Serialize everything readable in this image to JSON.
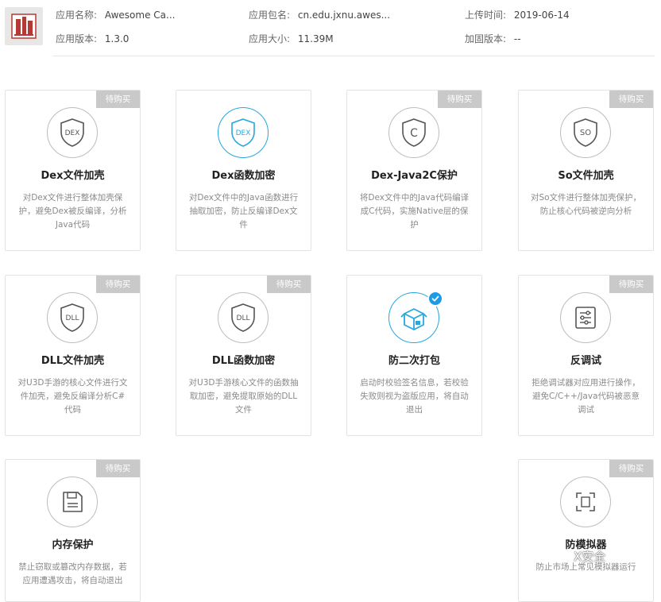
{
  "app": {
    "name_label": "应用名称:",
    "name_value": "Awesome Ca...",
    "package_label": "应用包名:",
    "package_value": "cn.edu.jxnu.awes...",
    "upload_label": "上传时间:",
    "upload_value": "2019-06-14",
    "version_label": "应用版本:",
    "version_value": "1.3.0",
    "size_label": "应用大小:",
    "size_value": "11.39M",
    "harden_label": "加固版本:",
    "harden_value": "--"
  },
  "ribbon_text": "待购买",
  "cards": [
    {
      "title": "Dex文件加壳",
      "icon": "dex-shield-icon",
      "badge": "待购买",
      "purchased": false,
      "desc": [
        "对Dex文件进行整体加壳保",
        "护，避免Dex被反编译，分析",
        "Java代码"
      ]
    },
    {
      "title": "Dex函数加密",
      "icon": "dex-shield-icon",
      "badge": "",
      "purchased": false,
      "desc": [
        "对Dex文件中的Java函数进行",
        "抽取加密，防止反编译Dex文",
        "件"
      ]
    },
    {
      "title": "Dex-Java2C保护",
      "icon": "c-shield-icon",
      "badge": "待购买",
      "purchased": false,
      "desc": [
        "将Dex文件中的Java代码编译",
        "成C代码，实施Native层的保",
        "护"
      ]
    },
    {
      "title": "So文件加壳",
      "icon": "so-shield-icon",
      "badge": "待购买",
      "purchased": false,
      "desc": [
        "对So文件进行整体加壳保护，",
        "防止核心代码被逆向分析"
      ]
    },
    {
      "title": "DLL文件加壳",
      "icon": "dll-shield-icon",
      "badge": "待购买",
      "purchased": false,
      "desc": [
        "对U3D手游的核心文件进行文",
        "件加壳，避免反编译分析C#",
        "代码"
      ]
    },
    {
      "title": "DLL函数加密",
      "icon": "dll-shield-icon",
      "badge": "待购买",
      "purchased": false,
      "desc": [
        "对U3D手游核心文件的函数抽",
        "取加密，避免提取原始的DLL",
        "文件"
      ]
    },
    {
      "title": "防二次打包",
      "icon": "package-icon",
      "badge": "",
      "purchased": true,
      "desc": [
        "启动时校验签名信息，若校验",
        "失败则视为盗版应用，将自动",
        "退出"
      ]
    },
    {
      "title": "反调试",
      "icon": "settings-sliders-icon",
      "badge": "待购买",
      "purchased": false,
      "desc": [
        "拒绝调试器对应用进行操作，",
        "避免C/C++/Java代码被恶意",
        "调试"
      ]
    },
    {
      "title": "内存保护",
      "icon": "floppy-disk-icon",
      "badge": "待购买",
      "purchased": false,
      "desc": [
        "禁止窃取或篡改内存数据，若",
        "应用遭遇攻击，将自动退出"
      ]
    },
    {
      "title": "防模拟器",
      "icon": "emulator-icon",
      "badge": "待购买",
      "purchased": false,
      "desc": [
        "防止市场上常见模拟器运行"
      ]
    }
  ],
  "watermark": "X安全"
}
